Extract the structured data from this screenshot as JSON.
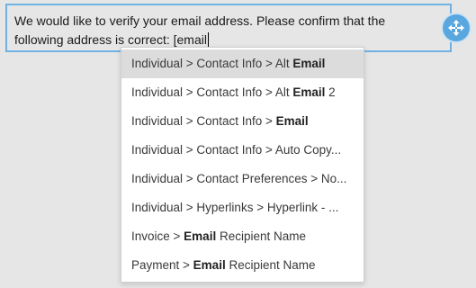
{
  "editor": {
    "text": "We would like to verify your email address. Please confirm that the following address is correct: [email"
  },
  "dropdown": {
    "items": [
      {
        "prefix": "Individual > Contact Info > Alt ",
        "match": "Email",
        "suffix": ""
      },
      {
        "prefix": "Individual > Contact Info > Alt ",
        "match": "Email",
        "suffix": " 2"
      },
      {
        "prefix": "Individual > Contact Info > ",
        "match": "Email",
        "suffix": ""
      },
      {
        "prefix": "Individual > Contact Info > Auto Copy...",
        "match": "",
        "suffix": ""
      },
      {
        "prefix": "Individual > Contact Preferences > No...",
        "match": "",
        "suffix": ""
      },
      {
        "prefix": "Individual > Hyperlinks > Hyperlink - ...",
        "match": "",
        "suffix": ""
      },
      {
        "prefix": "Invoice > ",
        "match": "Email",
        "suffix": " Recipient Name"
      },
      {
        "prefix": "Payment > ",
        "match": "Email",
        "suffix": " Recipient Name"
      }
    ],
    "selected_index": 0
  },
  "icons": {
    "move_handle": "move-arrows-icon"
  },
  "colors": {
    "accent": "#5aa7df",
    "editor_border": "#6fb2e3",
    "selected_item": "#dcdcdc"
  }
}
